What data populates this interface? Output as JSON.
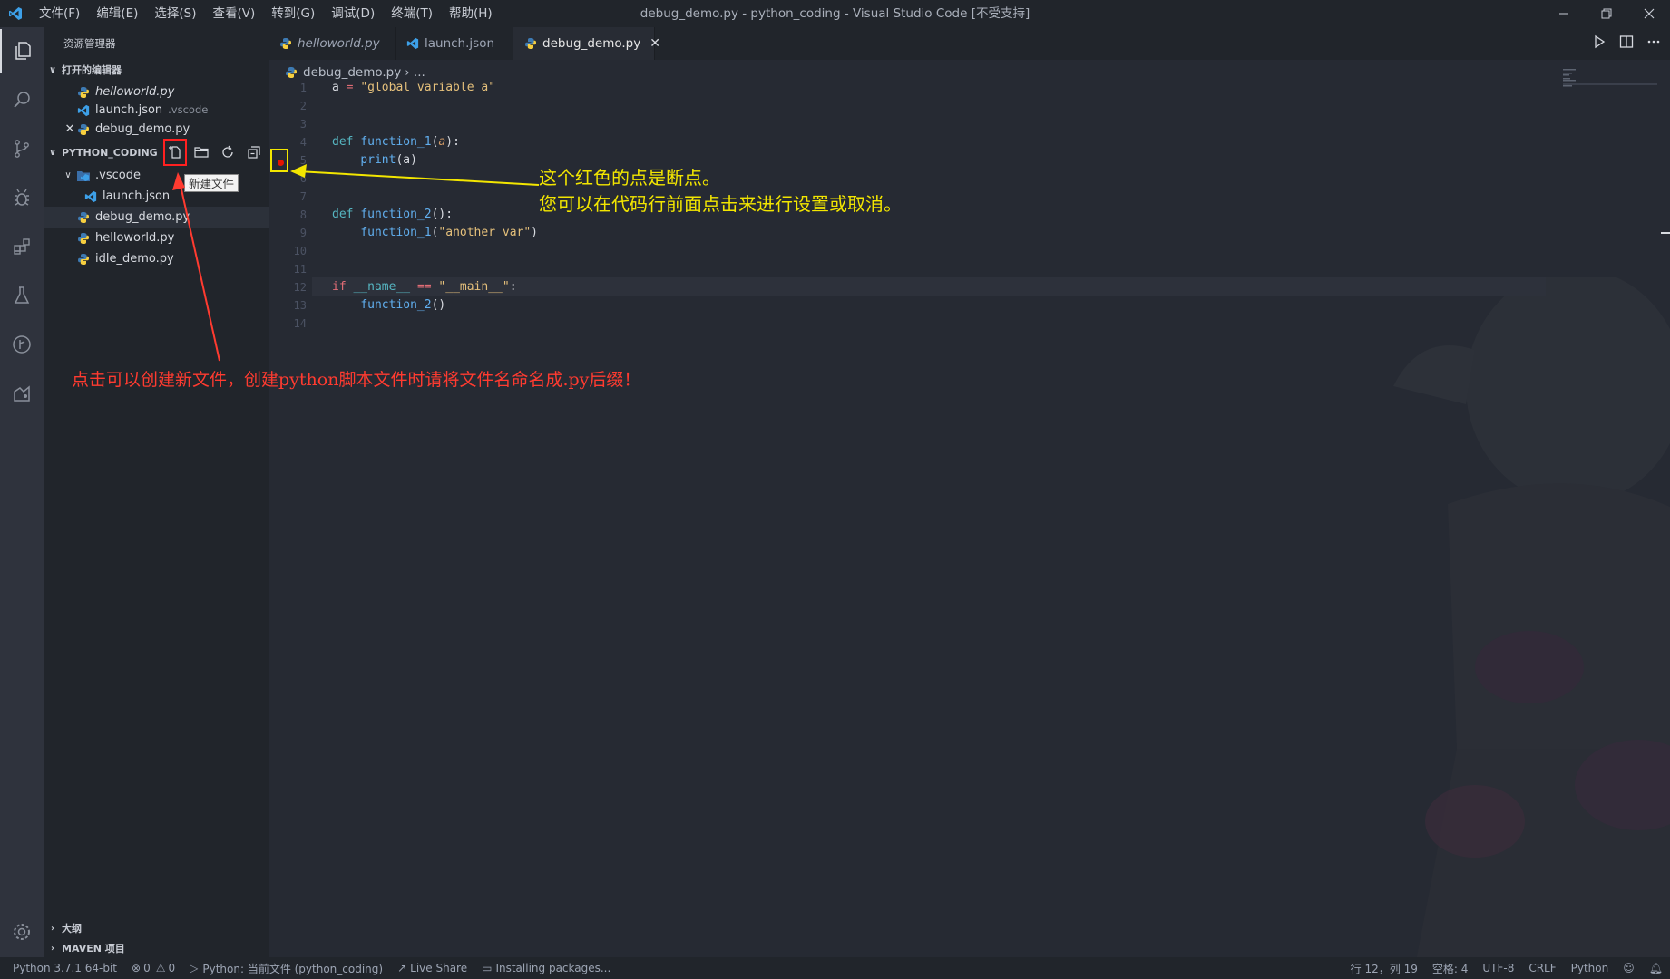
{
  "titlebar": {
    "menu": [
      "文件(F)",
      "编辑(E)",
      "选择(S)",
      "查看(V)",
      "转到(G)",
      "调试(D)",
      "终端(T)",
      "帮助(H)"
    ],
    "title": "debug_demo.py - python_coding - Visual Studio Code [不受支持]"
  },
  "sidebar": {
    "title": "资源管理器",
    "open_editors_header": "打开的编辑器",
    "open_editors": [
      {
        "name": "helloworld.py",
        "desc": "",
        "icon": "python-icon"
      },
      {
        "name": "launch.json",
        "desc": ".vscode",
        "icon": "vscode-icon"
      },
      {
        "name": "debug_demo.py",
        "desc": "",
        "icon": "python-icon"
      }
    ],
    "project_header": "PYTHON_CODING",
    "tree": [
      {
        "name": ".vscode",
        "icon": "vscode-folder-icon"
      },
      {
        "name": "launch.json",
        "icon": "vscode-icon"
      },
      {
        "name": "debug_demo.py",
        "icon": "python-icon"
      },
      {
        "name": "helloworld.py",
        "icon": "python-icon"
      },
      {
        "name": "idle_demo.py",
        "icon": "python-icon"
      }
    ],
    "tooltip": "新建文件",
    "outline_header": "大纲",
    "maven_header": "MAVEN 项目"
  },
  "tabs": [
    {
      "label": "helloworld.py",
      "icon": "python-icon"
    },
    {
      "label": "launch.json",
      "icon": "vscode-icon"
    },
    {
      "label": "debug_demo.py",
      "icon": "python-icon"
    }
  ],
  "editor": {
    "breadcrumb_file": "debug_demo.py",
    "breadcrumb_rest": "› ...",
    "line_numbers": [
      "1",
      "2",
      "3",
      "4",
      "5",
      "6",
      "7",
      "8",
      "9",
      "10",
      "11",
      "12",
      "13",
      "14"
    ]
  },
  "annotations": {
    "breakpoint_line1": "这个红色的点是断点。",
    "breakpoint_line2": "您可以在代码行前面点击来进行设置或取消。",
    "newfile": "点击可以创建新文件，创建python脚本文件时请将文件名命名成.py后缀！"
  },
  "status": {
    "interpreter": "Python 3.7.1 64-bit",
    "errors": "0",
    "warnings": "0",
    "run_target": "Python: 当前文件 (python_coding)",
    "live_share": "Live Share",
    "installing": "Installing packages...",
    "position": "行 12，列 19",
    "indent": "空格: 4",
    "encoding": "UTF-8",
    "eol": "CRLF",
    "language": "Python"
  },
  "colors": {
    "accent_yellow": "#f3e600",
    "annotation_red": "#ff3b30",
    "breakpoint": "#e51400"
  }
}
